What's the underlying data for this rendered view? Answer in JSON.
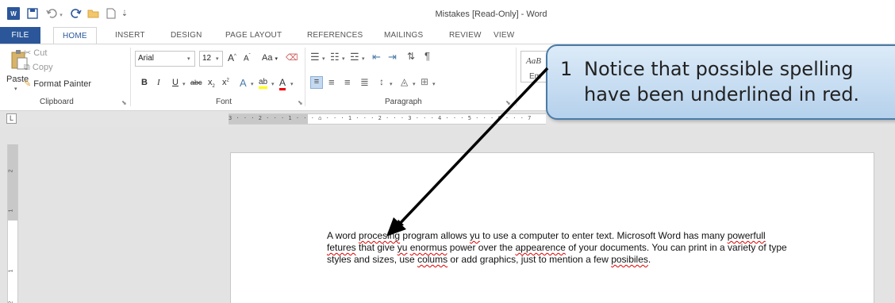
{
  "title_bar": {
    "window_title": "Mistakes [Read-Only] - Word",
    "icons": [
      "word-logo",
      "save-icon",
      "undo-icon",
      "redo-icon",
      "open-icon",
      "new-icon",
      "customize-qat-icon"
    ],
    "word_logo": "W"
  },
  "tabs": [
    {
      "label": "FILE"
    },
    {
      "label": "HOME"
    },
    {
      "label": "INSERT"
    },
    {
      "label": "DESIGN"
    },
    {
      "label": "PAGE LAYOUT"
    },
    {
      "label": "REFERENCES"
    },
    {
      "label": "MAILINGS"
    },
    {
      "label": "REVIEW"
    },
    {
      "label": "VIEW"
    }
  ],
  "ribbon": {
    "clipboard": {
      "group_label": "Clipboard",
      "paste_label": "Paste",
      "cut_label": "Cut",
      "copy_label": "Copy",
      "format_painter_label": "Format Painter"
    },
    "font": {
      "group_label": "Font",
      "font_name": "Arial",
      "font_size": "12",
      "grow": "A",
      "shrink": "A",
      "change_case": "Aa",
      "bold": "B",
      "italic": "I",
      "underline": "U",
      "strikethrough": "abc",
      "subscript": "x",
      "superscript": "x",
      "text_effects": "A",
      "highlight": "ab",
      "font_color": "A"
    },
    "paragraph": {
      "group_label": "Paragraph"
    },
    "styles": {
      "preview": "AaB",
      "style_name": "Em"
    }
  },
  "ruler": {
    "top_marks": "3 · · · 2 · · · 1 · · · ⌂ · · · 1 · · · 2 · · · 3 · · · 4 · · · 5 · · · 6 · · · 7",
    "corner": "L",
    "left_marks": [
      "2",
      "1",
      "1",
      "2"
    ]
  },
  "document": {
    "paragraph": [
      {
        "text": "A word ",
        "error": false
      },
      {
        "text": "procesing",
        "error": true
      },
      {
        "text": " program allows ",
        "error": false
      },
      {
        "text": "yu",
        "error": true
      },
      {
        "text": " to use a computer to enter text.  Microsoft Word has many ",
        "error": false
      },
      {
        "text": "powerfull",
        "error": true
      },
      {
        "text": " ",
        "error": false
      },
      {
        "text": "fetures",
        "error": true
      },
      {
        "text": " that give ",
        "error": false
      },
      {
        "text": "yu",
        "error": true
      },
      {
        "text": " ",
        "error": false
      },
      {
        "text": "enormus",
        "error": true
      },
      {
        "text": " power over the ",
        "error": false
      },
      {
        "text": "appearence",
        "error": true
      },
      {
        "text": " of your documents.  You can print in a variety of type styles and sizes, use ",
        "error": false
      },
      {
        "text": "colums",
        "error": true
      },
      {
        "text": " or add graphics, just to mention a few ",
        "error": false
      },
      {
        "text": "posibiles",
        "error": true
      },
      {
        "text": ".",
        "error": false
      }
    ]
  },
  "callout": {
    "number": "1",
    "line1": "Notice that possible spelling",
    "line2": "have been underlined in red."
  },
  "colors": {
    "accent": "#2b579a",
    "spelling_error": "#dd0000",
    "callout_border": "#4a7ba7",
    "arrow": "#000000"
  }
}
